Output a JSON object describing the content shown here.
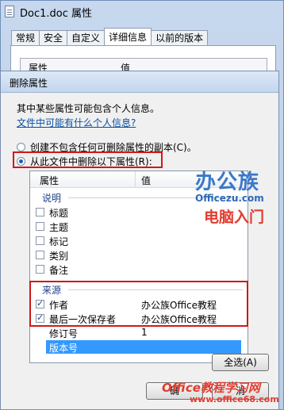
{
  "outer_window": {
    "title": "Doc1.doc 属性",
    "tabs": [
      "常规",
      "安全",
      "自定义",
      "详细信息",
      "以前的版本"
    ],
    "active_tab": 3,
    "header_col1": "属性",
    "header_col2": "值"
  },
  "dialog": {
    "title": "删除属性",
    "intro": "其中某些属性可能包含个人信息。",
    "privacy_link": "文件中可能有什么个人信息?",
    "option_copy": "创建不包含任何可删除属性的副本(C)。",
    "option_remove": "从此文件中删除以下属性(R):",
    "selected_option": "option_remove",
    "list": {
      "col_property": "属性",
      "col_value": "值",
      "group_description": "说明",
      "description_rows": [
        {
          "name": "标题",
          "value": "",
          "checked": false
        },
        {
          "name": "主题",
          "value": "",
          "checked": false
        },
        {
          "name": "标记",
          "value": "",
          "checked": false
        },
        {
          "name": "类别",
          "value": "",
          "checked": false
        },
        {
          "name": "备注",
          "value": "",
          "checked": false
        }
      ],
      "group_origin": "来源",
      "origin_rows": [
        {
          "name": "作者",
          "value": "办公族Office教程",
          "checked": true
        },
        {
          "name": "最后一次保存者",
          "value": "办公族Office教程",
          "checked": true
        },
        {
          "name": "修订号",
          "value": "1",
          "checked": null
        },
        {
          "name": "版本号",
          "value": "",
          "checked": null,
          "selected": true
        }
      ]
    },
    "select_all_button": "全选(A)",
    "ok_button": "确",
    "cancel_button": "消"
  },
  "watermark": {
    "brand": "办公族",
    "domain": "Officezu.com",
    "slogan": "电脑入门",
    "footer": "Office教程学习网",
    "footer_url": "www.office68.com"
  }
}
